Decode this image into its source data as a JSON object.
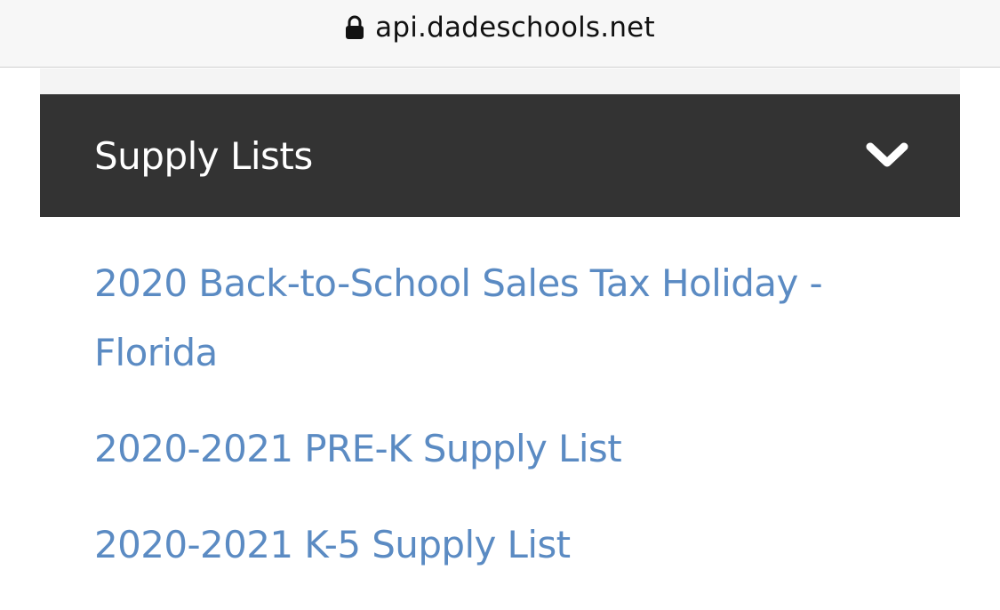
{
  "browser": {
    "url": "api.dadeschools.net",
    "lock_icon": "lock-icon"
  },
  "accordion": {
    "title": "Supply Lists",
    "toggle_icon": "chevron-down-icon",
    "header_background": "#333333",
    "header_text_color": "#ffffff"
  },
  "links": {
    "color": "#5b8bc3",
    "items": [
      {
        "label": "2020 Back-to-School Sales Tax Holiday - Florida"
      },
      {
        "label": "2020-2021 PRE-K Supply List"
      },
      {
        "label": "2020-2021 K-5 Supply List"
      }
    ]
  }
}
